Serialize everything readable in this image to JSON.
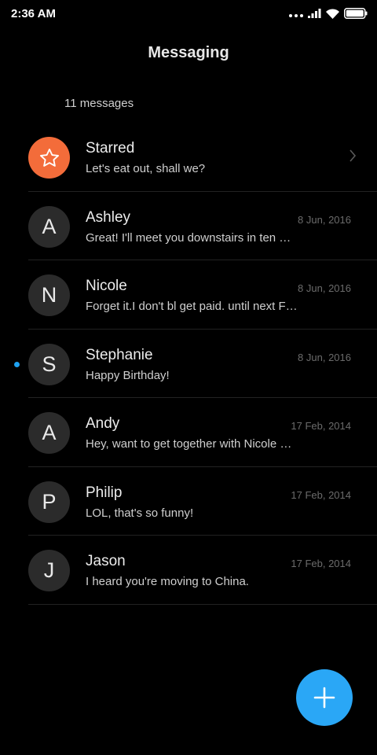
{
  "status_bar": {
    "time": "2:36 AM",
    "icons": [
      "more-dots-icon",
      "signal-icon",
      "wifi-icon",
      "battery-icon"
    ]
  },
  "header": {
    "title": "Messaging",
    "count_label": "11 messages"
  },
  "conversations": [
    {
      "name": "Starred",
      "avatar": "star-icon",
      "preview": "Let's eat out, shall we?",
      "date": "",
      "unread": false
    },
    {
      "name": "Ashley",
      "avatar": "A",
      "preview": "Great! I'll meet you downstairs in ten …",
      "date": "8 Jun, 2016",
      "unread": false
    },
    {
      "name": "Nicole",
      "avatar": "N",
      "preview": "Forget it.I don't bl get paid. until next F…",
      "date": "8 Jun, 2016",
      "unread": false
    },
    {
      "name": "Stephanie",
      "avatar": "S",
      "preview": "Happy Birthday!",
      "date": "8 Jun, 2016",
      "unread": true
    },
    {
      "name": "Andy",
      "avatar": "A",
      "preview": "Hey, want to get together with Nicole …",
      "date": "17 Feb, 2014",
      "unread": false
    },
    {
      "name": "Philip",
      "avatar": "P",
      "preview": "LOL, that's so funny!",
      "date": "17 Feb, 2014",
      "unread": false
    },
    {
      "name": "Jason",
      "avatar": "J",
      "preview": "I heard you're moving to China.",
      "date": "17 Feb, 2014",
      "unread": false
    }
  ],
  "fab": {
    "icon": "plus-icon"
  },
  "colors": {
    "background": "#000000",
    "starred_accent": "#f36c3a",
    "fab": "#2aa7f6",
    "unread_dot": "#1ea1f1"
  }
}
